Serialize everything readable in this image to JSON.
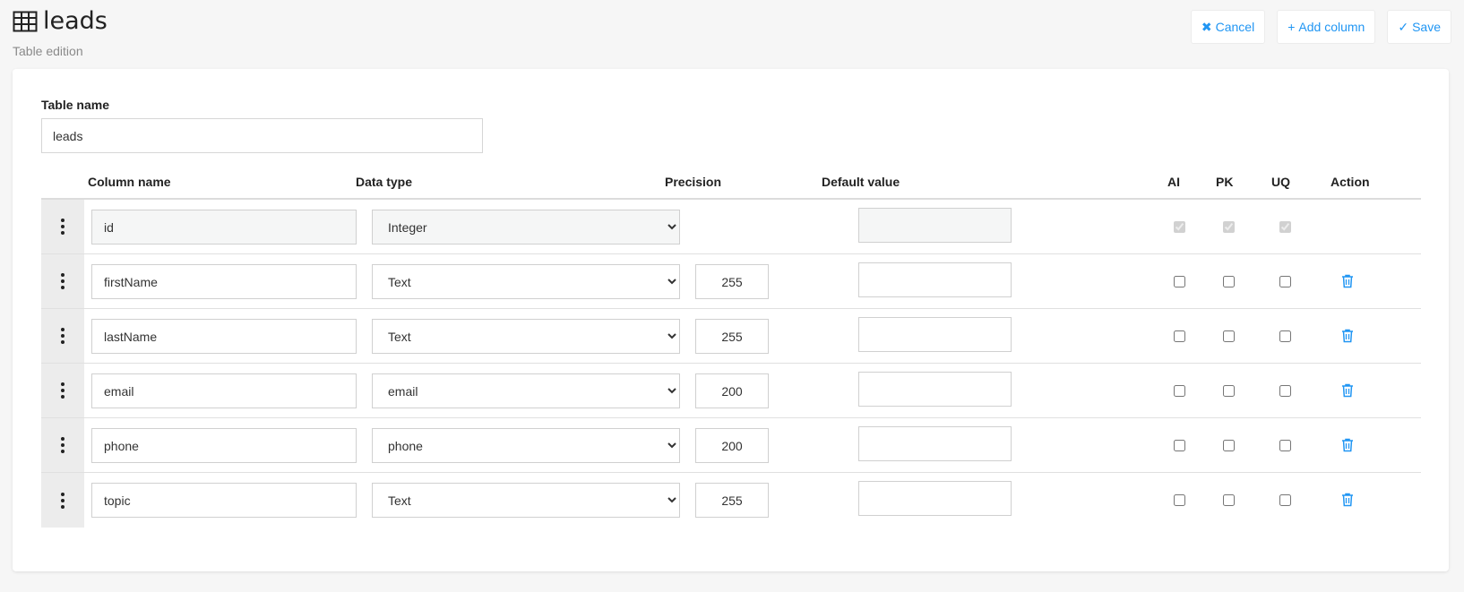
{
  "header": {
    "title": "leads",
    "subtitle": "Table edition",
    "icon": "table-icon"
  },
  "toolbar": {
    "cancel_label": "Cancel",
    "add_column_label": "Add column",
    "save_label": "Save",
    "accent_color": "#2196f3"
  },
  "form": {
    "table_name_label": "Table name",
    "table_name_value": "leads"
  },
  "columns_table": {
    "headers": {
      "column_name": "Column name",
      "data_type": "Data type",
      "precision": "Precision",
      "default_value": "Default value",
      "ai": "AI",
      "pk": "PK",
      "uq": "UQ",
      "action": "Action"
    },
    "rows": [
      {
        "name": "id",
        "type": "Integer",
        "precision": "",
        "default": "",
        "ai": true,
        "pk": true,
        "uq": true
      },
      {
        "name": "firstName",
        "type": "Text",
        "precision": "255",
        "default": "",
        "ai": false,
        "pk": false,
        "uq": false
      },
      {
        "name": "lastName",
        "type": "Text",
        "precision": "255",
        "default": "",
        "ai": false,
        "pk": false,
        "uq": false
      },
      {
        "name": "email",
        "type": "email",
        "precision": "200",
        "default": "",
        "ai": false,
        "pk": false,
        "uq": false
      },
      {
        "name": "phone",
        "type": "phone",
        "precision": "200",
        "default": "",
        "ai": false,
        "pk": false,
        "uq": false
      },
      {
        "name": "topic",
        "type": "Text",
        "precision": "255",
        "default": "",
        "ai": false,
        "pk": false,
        "uq": false
      }
    ]
  }
}
